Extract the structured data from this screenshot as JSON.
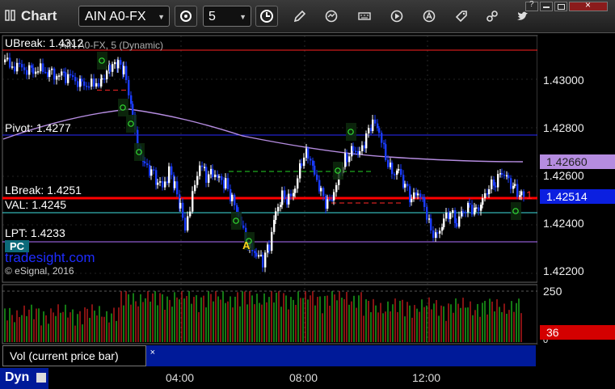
{
  "toolbar": {
    "title": "Chart",
    "symbol": "AIN A0-FX",
    "interval": "5"
  },
  "chart": {
    "header_text": "AIN A0-FX, 5 (Dynamic)",
    "lines": {
      "ubreak": "UBreak: 1.4312",
      "pivot": "Pivot: 1.4277",
      "lbreak": "LBreak: 1.4251",
      "val": "VAL: 1.4245",
      "lpt": "LPT: 1.4233"
    },
    "pc_label": "PC",
    "brand": "tradesight.com",
    "copyright": "© eSignal, 2016",
    "price_axis": [
      "1.43000",
      "1.42800",
      "1.42600",
      "1.42400",
      "1.42200"
    ],
    "ma_value": "1.42660",
    "last_price": "1.42514",
    "marker_one": "1",
    "marker_a": "A",
    "volume_axis": [
      "250",
      "0"
    ],
    "volume_last": "36",
    "volume_tab": "Vol (current price bar)",
    "volume_close": "×",
    "time_axis": [
      "04:00",
      "08:00",
      "12:00"
    ],
    "footer_label": "Dyn",
    "colors": {
      "up_candle": "#ffffff",
      "down_candle": "#1a3cff",
      "ubreak_line": "#ff2020",
      "pivot_line": "#2a2aff",
      "lbreak_line": "#ff0000",
      "val_line": "#40e0e0",
      "lpt_line": "#b070ff",
      "ma_line": "#b58ce0",
      "brand": "#1e2cff"
    }
  }
}
